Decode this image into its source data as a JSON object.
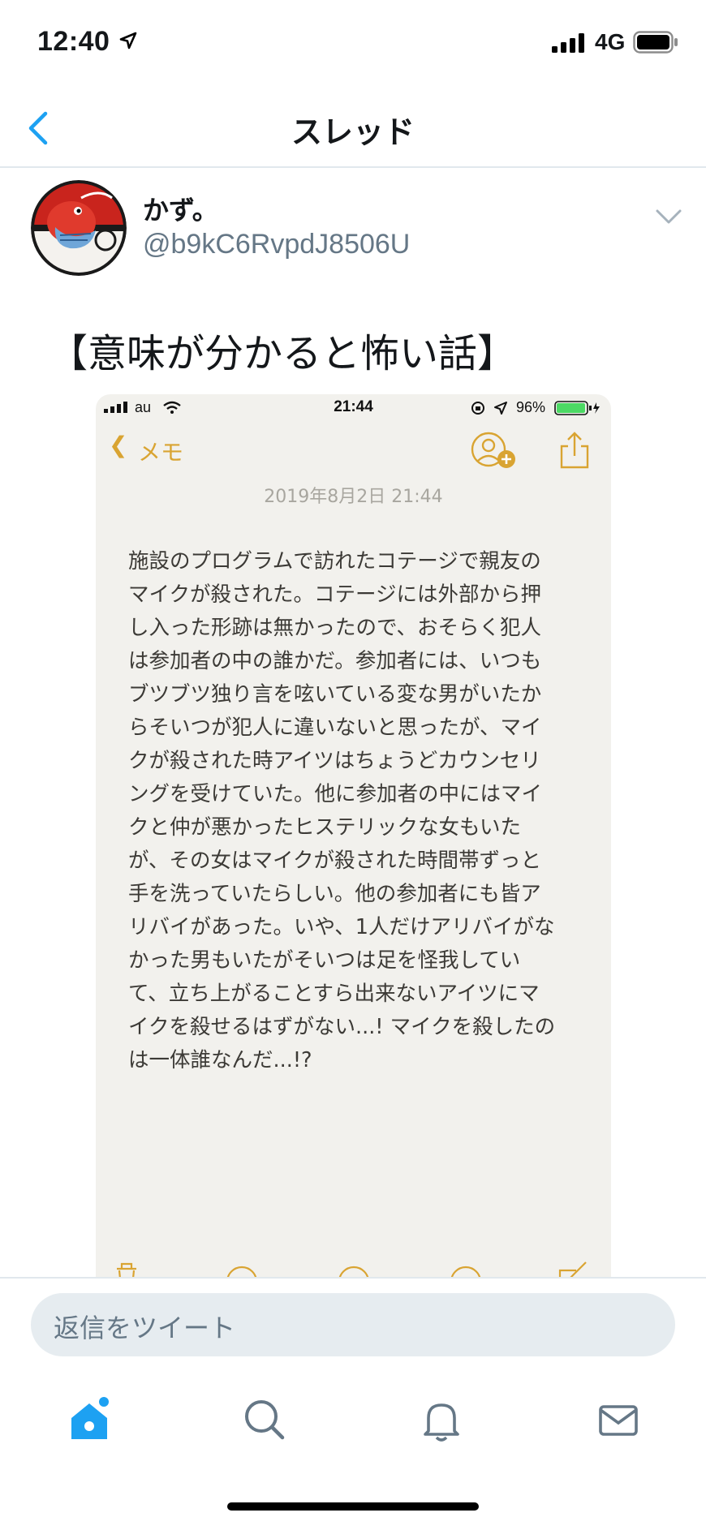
{
  "status_bar": {
    "time": "12:40",
    "network": "4G"
  },
  "nav": {
    "title": "スレッド"
  },
  "tweet": {
    "display_name": "かず。",
    "handle": "@b9kC6RvpdJ8506U",
    "text": "【意味が分かると怖い話】"
  },
  "media": {
    "carrier": "au",
    "time": "21:44",
    "battery": "96%",
    "back_label": "メモ",
    "date": "2019年8月2日 21:44",
    "lines": [
      "施設のプログラムで訪れたコテージで親友の",
      "マイクが殺された。コテージには外部から押",
      "し入った形跡は無かったので、おそらく犯人",
      "は参加者の中の誰かだ。参加者には、いつも",
      "ブツブツ独り言を呟いている変な男がいたか",
      "らそいつが犯人に違いないと思ったが、マイ",
      "クが殺された時アイツはちょうどカウンセリ",
      "ングを受けていた。他に参加者の中にはマイ",
      "クと仲が悪かったヒステリックな女もいた",
      "が、その女はマイクが殺された時間帯ずっと",
      "手を洗っていたらしい。他の参加者にも皆ア",
      "リバイがあった。いや、1人だけアリバイがな",
      "かった男もいたがそいつは足を怪我してい",
      "て、立ち上がることすら出来ないアイツにマ",
      "イクを殺せるはずがない...! マイクを殺したの",
      "は一体誰なんだ...!?"
    ]
  },
  "compose": {
    "placeholder": "返信をツイート"
  },
  "colors": {
    "accent": "#1da1f2",
    "notes_gold": "#d9a432",
    "muted": "#657786"
  },
  "tabs": [
    "home-icon",
    "search-icon",
    "bell-icon",
    "mail-icon"
  ]
}
